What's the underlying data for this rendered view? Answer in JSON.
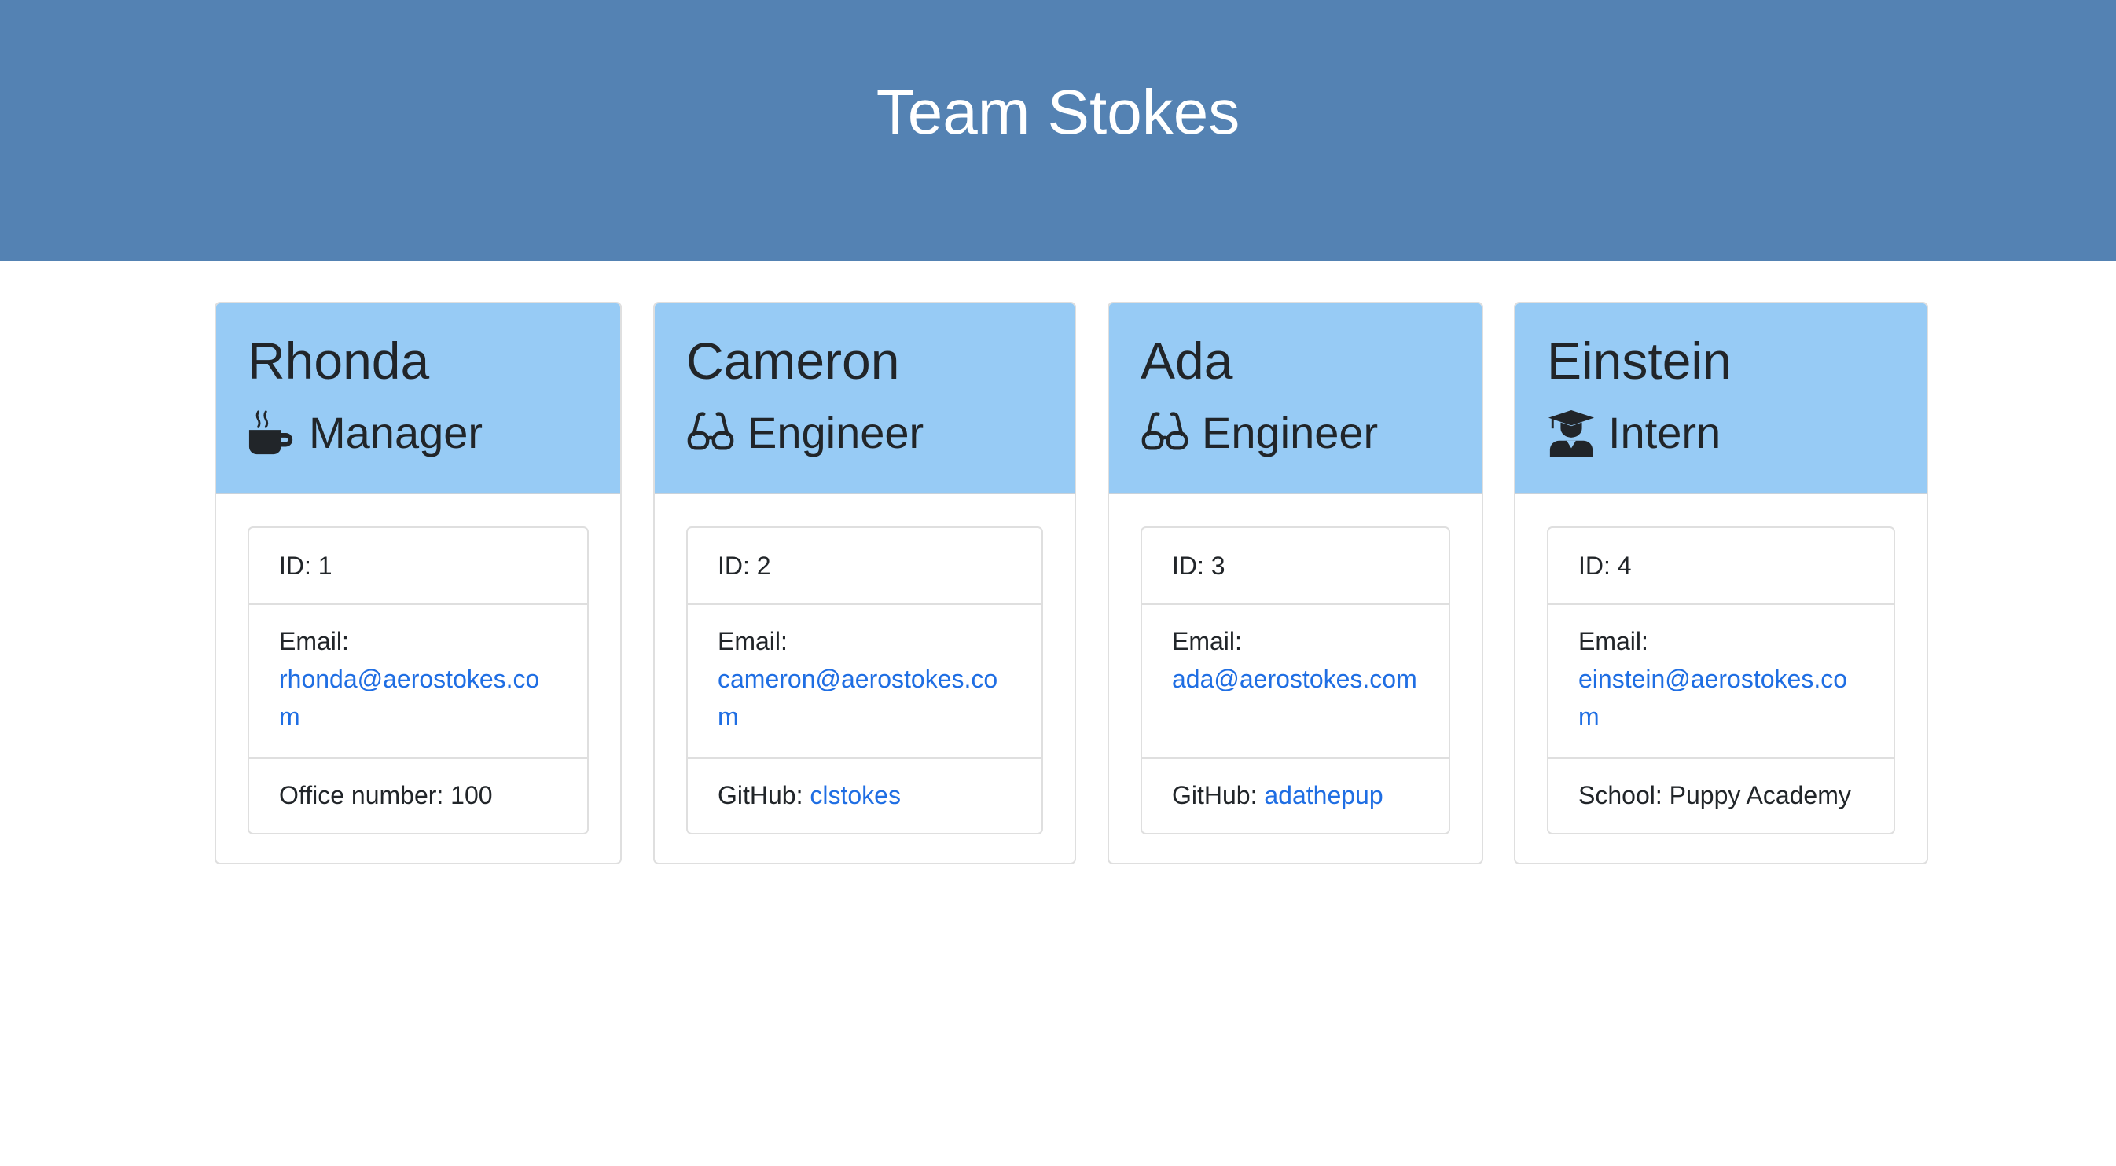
{
  "page_title": "Team Stokes",
  "colors": {
    "header_bg": "#5482b3",
    "card_header_bg": "#97cbf5",
    "link": "#1f6ee3"
  },
  "members": [
    {
      "name": "Rhonda",
      "role": "Manager",
      "role_icon": "coffee-mug-icon",
      "id_label": "ID: 1",
      "email_label": "Email:",
      "email": "rhonda@aerostokes.com",
      "extra_label": "Office number: 100",
      "extra_link": ""
    },
    {
      "name": "Cameron",
      "role": "Engineer",
      "role_icon": "glasses-icon",
      "id_label": "ID: 2",
      "email_label": "Email:",
      "email": "cameron@aerostokes.com",
      "extra_label": "GitHub: ",
      "extra_link": "clstokes"
    },
    {
      "name": "Ada",
      "role": "Engineer",
      "role_icon": "glasses-icon",
      "id_label": "ID: 3",
      "email_label": "Email:",
      "email": "ada@aerostokes.com",
      "extra_label": "GitHub: ",
      "extra_link": "adathepup"
    },
    {
      "name": "Einstein",
      "role": "Intern",
      "role_icon": "graduate-icon",
      "id_label": "ID: 4",
      "email_label": "Email:",
      "email": "einstein@aerostokes.com",
      "extra_label": "School: Puppy Academy",
      "extra_link": ""
    }
  ]
}
